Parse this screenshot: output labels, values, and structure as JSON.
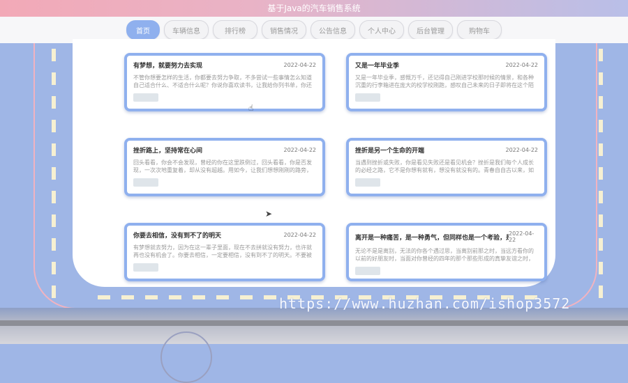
{
  "window": {
    "title": "基于Java的汽车销售系统"
  },
  "nav": {
    "items": [
      {
        "label": "首页",
        "active": true
      },
      {
        "label": "车辆信息"
      },
      {
        "label": "排行榜"
      },
      {
        "label": "销售情况"
      },
      {
        "label": "公告信息"
      },
      {
        "label": "个人中心"
      },
      {
        "label": "后台管理"
      },
      {
        "label": "购物车"
      }
    ]
  },
  "cards": [
    {
      "title": "有梦想，就要努力去实现",
      "date": "2022-04-22",
      "body": "不管你想要怎样的生活，你都要去努力争取，不多尝试一些事情怎么知道自己适合什么、不适合什么呢？你说你喜欢读书，让我给你列书单，你还问我要哪。"
    },
    {
      "title": "又是一年毕业季",
      "date": "2022-04-22",
      "body": "又是一年毕业季，感慨万千，还记得自己刚进学校那时候的情景，和各种沉重的行李箱进在庞大的校学校刚跑，感叹自己未来的日子即将在这个陌生的校"
    },
    {
      "title": "挫折路上，坚持常在心间",
      "date": "2022-04-22",
      "body": "回头看看，你会不会发现，曾经的你在这里跌倒过，回头看看，你是否发现，一次次地重复着，却从没有超越。用如今，让我们想想刚刚的路旁，那一遍遍，"
    },
    {
      "title": "挫折是另一个生命的开端",
      "date": "2022-04-22",
      "body": "当遇到挫折或失败，你是看见失败还是看见机会？挫折是我们每个人成长的必经之路，它不是你想有就有，想没有就没有的。青春自自古以来，如果你想一"
    },
    {
      "title": "你要去相信，没有到不了的明天",
      "date": "2022-04-22",
      "body": "有梦想就去努力，因为在这一辈子里面，现在不去拼就没有努力，也许就再也没有机会了。你要去相信，一定要相信，没有到不了的明天。不要被你这打败。"
    },
    {
      "title": "离开是一种痛苦，是一种勇气，但同样也是一个考验，是一个新...",
      "date": "2022-04-22",
      "body": "无论不是是离别，无法的你各个遇过思，当离别前那之时，当远方看你的以前的好朋友时，当面对你曾经的四年的那个那些形成的真挚友谊之时，我内心都"
    }
  ],
  "watermark": "https://www.huzhan.com/ishop3572"
}
